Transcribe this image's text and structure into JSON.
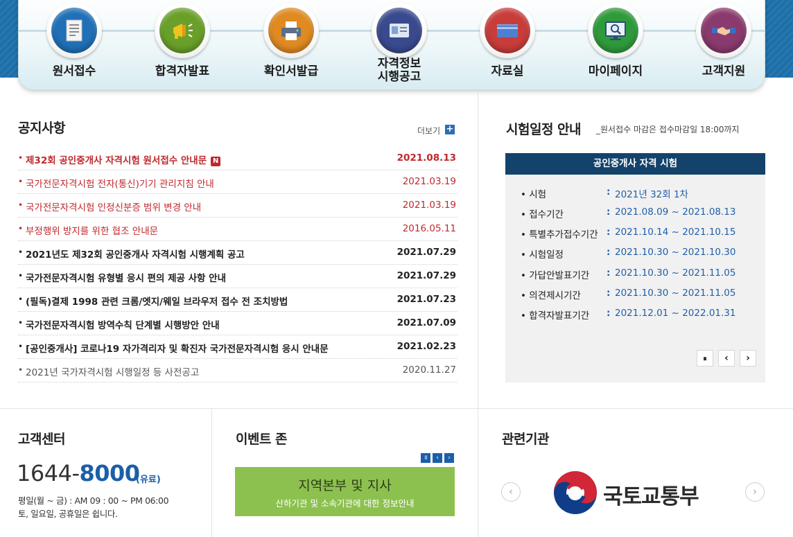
{
  "nav": {
    "items": [
      {
        "label": "원서접수",
        "icon": "document-icon",
        "color": "#1f70b7"
      },
      {
        "label": "합격자발표",
        "icon": "megaphone-icon",
        "color": "#6aa02a"
      },
      {
        "label": "확인서발급",
        "icon": "printer-icon",
        "color": "#e08a22"
      },
      {
        "label_line1": "자격정보",
        "label_line2": "시행공고",
        "icon": "id-card-icon",
        "color": "#3a4a8e"
      },
      {
        "label": "자료실",
        "icon": "folder-icon",
        "color": "#c83d3a"
      },
      {
        "label": "마이페이지",
        "icon": "monitor-search-icon",
        "color": "#2f9a3b"
      },
      {
        "label": "고객지원",
        "icon": "handshake-icon",
        "color": "#8a3a6e"
      }
    ]
  },
  "notices": {
    "title": "공지사항",
    "more_label": "더보기",
    "more_icon": "plus-icon",
    "new_badge": "N",
    "rows": [
      {
        "title": "제32회 공인중개사 자격시험 원서접수 안내문",
        "date": "2021.08.13"
      },
      {
        "title": "국가전문자격시험 전자(통신)기기 관리지침 안내",
        "date": "2021.03.19"
      },
      {
        "title": "국가전문자격시험 인정신분증 범위 변경 안내",
        "date": "2021.03.19"
      },
      {
        "title": "부정행위 방지를 위한 협조 안내문",
        "date": "2016.05.11"
      },
      {
        "title": "2021년도 제32회 공인중개사 자격시험 시행계획 공고",
        "date": "2021.07.29"
      },
      {
        "title": "국가전문자격시험 유형별 응시 편의 제공 사항 안내",
        "date": "2021.07.29"
      },
      {
        "title": "(필독)결제 1998 관련 크롬/엣지/웨일 브라우저 접수 전 조치방법",
        "date": "2021.07.23"
      },
      {
        "title": "국가전문자격시험 방역수칙 단계별 시행방안 안내",
        "date": "2021.07.09"
      },
      {
        "title": "[공인중개사] 코로나19 자가격리자 및 확진자 국가전문자격시험 응시 안내문",
        "date": "2021.02.23"
      },
      {
        "title": "2021년 국가자격시험 시행일정 등 사전공고",
        "date": "2020.11.27"
      }
    ]
  },
  "schedule": {
    "title": "시험일정 안내",
    "subtitle": "_원서접수 마감은 접수마감일 18:00까지",
    "exam_name": "공인중개사 자격 시험",
    "bullet": "•",
    "colon": ":",
    "rows": [
      {
        "label": "시험",
        "value": "2021년 32회 1차"
      },
      {
        "label": "접수기간",
        "value": "2021.08.09 ~ 2021.08.13"
      },
      {
        "label": "특별추가접수기간",
        "value": "2021.10.14 ~ 2021.10.15"
      },
      {
        "label": "시험일정",
        "value": "2021.10.30 ~ 2021.10.30"
      },
      {
        "label": "가답안발표기간",
        "value": "2021.10.30 ~ 2021.11.05"
      },
      {
        "label": "의견제시기간",
        "value": "2021.10.30 ~ 2021.11.05"
      },
      {
        "label": "합격자발표기간",
        "value": "2021.12.01 ~ 2022.01.31"
      }
    ],
    "controls": {
      "pause": "⏸",
      "prev": "‹",
      "next": "›"
    }
  },
  "customer_center": {
    "title": "고객센터",
    "phone_prefix": "1644-",
    "phone_main": "8000",
    "paid_label": "(유료)",
    "hours_line1": "평일(월 ~ 금) : AM 09 : 00 ~ PM 06:00",
    "hours_line2": "토, 일요일, 공휴일은 쉽니다."
  },
  "event_zone": {
    "title": "이벤트 존",
    "controls": {
      "pause": "॥",
      "prev": "‹",
      "next": "›"
    },
    "banner_title": "지역본부 및 지사",
    "banner_sub": "산하기관 및 소속기관에 대한 정보안내"
  },
  "related": {
    "title": "관련기관",
    "org_name": "국토교통부",
    "prev": "‹",
    "next": "›"
  }
}
